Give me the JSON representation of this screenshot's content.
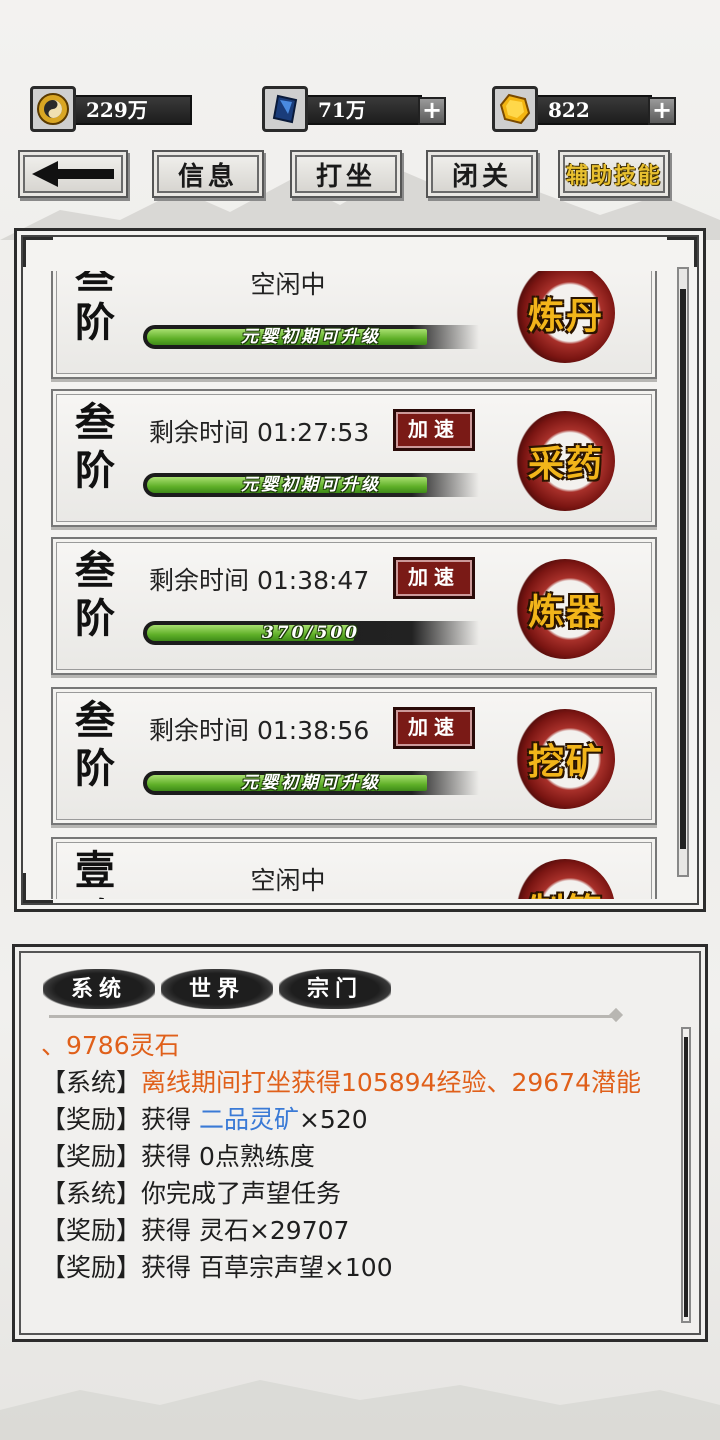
{
  "resources": [
    {
      "icon": "spirit-coin-icon",
      "value": "229万",
      "has_plus": false
    },
    {
      "icon": "blue-crystal-icon",
      "value": "71万",
      "has_plus": true
    },
    {
      "icon": "gold-gem-icon",
      "value": "822",
      "has_plus": true
    }
  ],
  "nav": {
    "back_icon": "back-arrow-icon",
    "info": "信息",
    "meditate": "打坐",
    "seclusion": "闭关",
    "aux_skills": "辅助技能"
  },
  "skills": [
    {
      "tier": "叁阶",
      "status": "空闲中",
      "timer": "",
      "speed": "",
      "progress_text": "元婴初期可升级",
      "progress": 1.0,
      "skill": "炼丹"
    },
    {
      "tier": "叁阶",
      "status": "",
      "timer": "剩余时间 01:27:53",
      "speed": "加速",
      "progress_text": "元婴初期可升级",
      "progress": 1.0,
      "skill": "采药"
    },
    {
      "tier": "叁阶",
      "status": "",
      "timer": "剩余时间 01:38:47",
      "speed": "加速",
      "progress_text": "370/500",
      "progress": 0.74,
      "skill": "炼器"
    },
    {
      "tier": "叁阶",
      "status": "",
      "timer": "剩余时间 01:38:56",
      "speed": "加速",
      "progress_text": "元婴初期可升级",
      "progress": 1.0,
      "skill": "挖矿"
    },
    {
      "tier": "壹阶",
      "status": "空闲中",
      "timer": "",
      "speed": "",
      "progress_text": "",
      "progress": 0,
      "skill": "制符"
    }
  ],
  "chat": {
    "tabs": [
      "系统",
      "世界",
      "宗门"
    ],
    "lines": [
      {
        "parts": [
          {
            "t": "、9786灵石",
            "c": "orange"
          }
        ]
      },
      {
        "parts": [
          {
            "t": "【系统】",
            "c": ""
          },
          {
            "t": "离线期间打坐获得105894经验、29674潜能",
            "c": "orange"
          }
        ]
      },
      {
        "parts": [
          {
            "t": "【奖励】获得 ",
            "c": ""
          },
          {
            "t": "二品灵矿",
            "c": "blue"
          },
          {
            "t": "×520",
            "c": ""
          }
        ]
      },
      {
        "parts": [
          {
            "t": "【奖励】获得 0点熟练度",
            "c": ""
          }
        ]
      },
      {
        "parts": [
          {
            "t": "【系统】你完成了声望任务",
            "c": ""
          }
        ]
      },
      {
        "parts": [
          {
            "t": "【奖励】获得 灵石×29707",
            "c": ""
          }
        ]
      },
      {
        "parts": [
          {
            "t": "【奖励】获得 百草宗声望×100",
            "c": ""
          }
        ]
      }
    ]
  },
  "colors": {
    "accent_gold": "#f2b51a",
    "seal_red": "#7a1512",
    "progress_green": "#5fb028",
    "log_orange": "#e0601a",
    "log_blue": "#3a7ad6"
  }
}
